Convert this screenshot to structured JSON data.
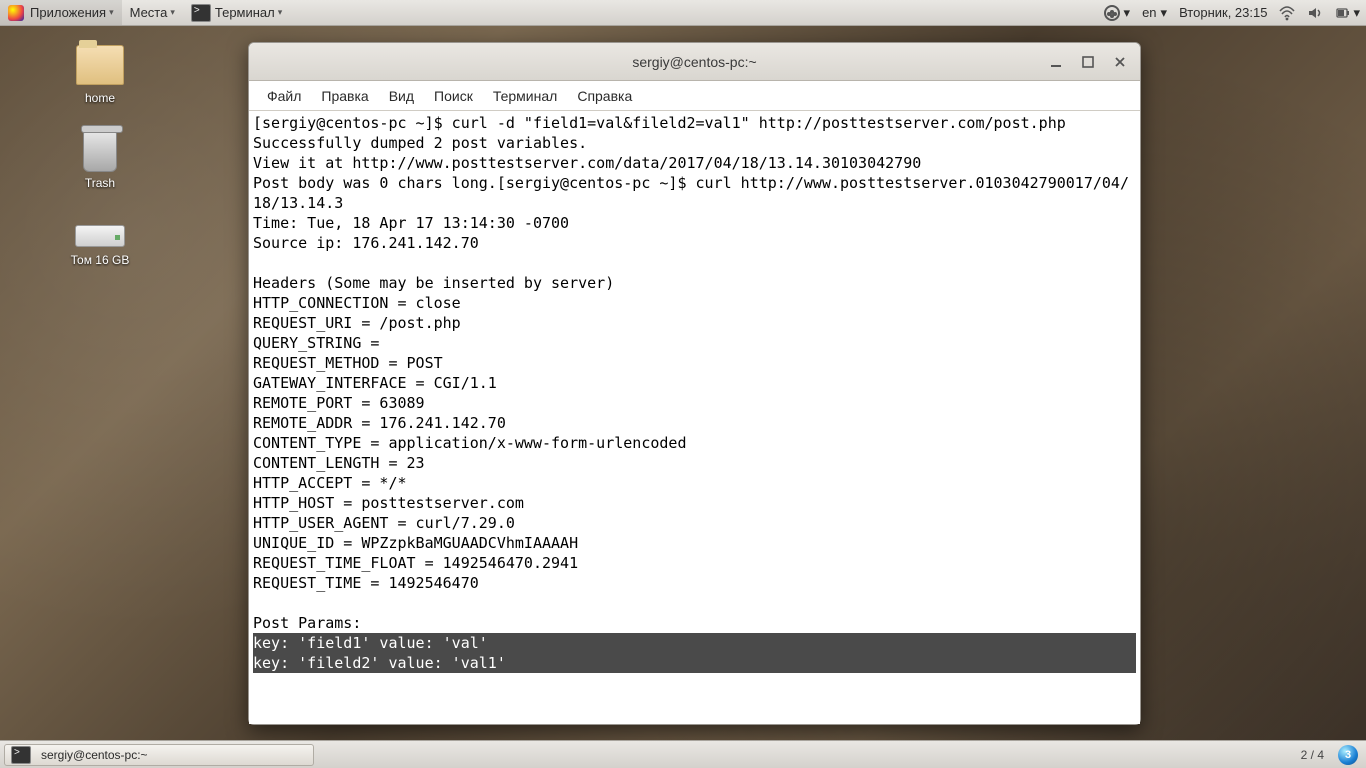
{
  "top": {
    "apps": "Приложения",
    "places": "Места",
    "terminal": "Терминал",
    "lang": "en",
    "clock": "Вторник, 23:15"
  },
  "desktop": {
    "home": "home",
    "trash": "Trash",
    "volume": "Том 16 GB"
  },
  "window": {
    "title": "sergiy@centos-pc:~",
    "menu": {
      "file": "Файл",
      "edit": "Правка",
      "view": "Вид",
      "search": "Поиск",
      "terminal": "Терминал",
      "help": "Справка"
    },
    "content_plain": "[sergiy@centos-pc ~]$ curl -d \"field1=val&fileld2=val1\" http://posttestserver.com/post.php\nSuccessfully dumped 2 post variables.\nView it at http://www.posttestserver.com/data/2017/04/18/13.14.30103042790\nPost body was 0 chars long.[sergiy@centos-pc ~]$ curl http://www.posttestserver.0103042790017/04/18/13.14.3\nTime: Tue, 18 Apr 17 13:14:30 -0700\nSource ip: 176.241.142.70\n\nHeaders (Some may be inserted by server)\nHTTP_CONNECTION = close\nREQUEST_URI = /post.php\nQUERY_STRING = \nREQUEST_METHOD = POST\nGATEWAY_INTERFACE = CGI/1.1\nREMOTE_PORT = 63089\nREMOTE_ADDR = 176.241.142.70\nCONTENT_TYPE = application/x-www-form-urlencoded\nCONTENT_LENGTH = 23\nHTTP_ACCEPT = */*\nHTTP_HOST = posttestserver.com\nHTTP_USER_AGENT = curl/7.29.0\nUNIQUE_ID = WPZzpkBaMGUAADCVhmIAAAAH\nREQUEST_TIME_FLOAT = 1492546470.2941\nREQUEST_TIME = 1492546470\n\nPost Params:",
    "content_selected": "key: 'field1' value: 'val'\nkey: 'fileld2' value: 'val1'"
  },
  "taskbar": {
    "task": "sergiy@centos-pc:~",
    "workspaces": "2 / 4",
    "badge": "3"
  }
}
